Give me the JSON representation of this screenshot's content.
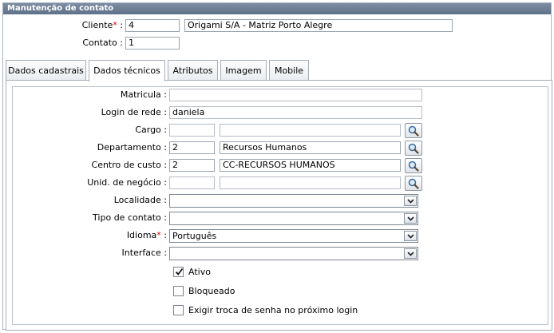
{
  "header": {
    "title": "Manutenção de contato"
  },
  "top": {
    "cliente_label": "Cliente",
    "cliente_required": "*",
    "cliente_sep": ":",
    "cliente_code": "4",
    "cliente_name": "Origami S/A - Matriz Porto Alegre",
    "contato_label": "Contato :",
    "contato_value": "1"
  },
  "tabs": [
    {
      "label": "Dados cadastrais",
      "active": false
    },
    {
      "label": "Dados técnicos",
      "active": true
    },
    {
      "label": "Atributos",
      "active": false
    },
    {
      "label": "Imagem",
      "active": false
    },
    {
      "label": "Mobile",
      "active": false
    }
  ],
  "form": {
    "matricula": {
      "label": "Matricula :",
      "value": ""
    },
    "login": {
      "label": "Login de rede :",
      "value": "daniela"
    },
    "cargo": {
      "label": "Cargo :",
      "code": "",
      "name": ""
    },
    "departamento": {
      "label": "Departamento :",
      "code": "2",
      "name": "Recursos Humanos"
    },
    "centro": {
      "label": "Centro de custo :",
      "code": "2",
      "name": "CC-RECURSOS HUMANOS"
    },
    "unid": {
      "label": "Unid. de negócio :",
      "code": "",
      "name": ""
    },
    "localidade": {
      "label": "Localidade :",
      "value": ""
    },
    "tipo": {
      "label": "Tipo de contato :",
      "value": ""
    },
    "idioma": {
      "label": "Idioma",
      "required": "*",
      "sep": ":",
      "value": "Português"
    },
    "interface": {
      "label": "Interface :",
      "value": ""
    }
  },
  "checkboxes": {
    "ativo": {
      "label": "Ativo",
      "checked": true
    },
    "bloqueado": {
      "label": "Bloqueado",
      "checked": false
    },
    "exigir": {
      "label": "Exigir troca de senha no próximo login",
      "checked": false
    }
  },
  "icons": {
    "search": "magnifier-icon",
    "dropdown": "chevron-down-icon",
    "check": "check-icon"
  },
  "colors": {
    "title_bar": "#6a7c93",
    "required": "#d40000",
    "border": "#a5adb7"
  }
}
